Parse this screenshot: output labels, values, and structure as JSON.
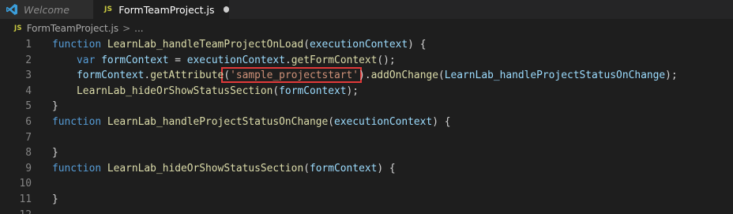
{
  "tabs": [
    {
      "label": "Welcome",
      "icon": "vscode-logo-icon",
      "active": false
    },
    {
      "label": "FormTeamProject.js",
      "icon": "js-file-icon",
      "icon_text": "JS",
      "active": true,
      "unsaved": true
    }
  ],
  "breadcrumb": {
    "icon_text": "JS",
    "file": "FormTeamProject.js",
    "separator": ">",
    "more": "..."
  },
  "editor": {
    "lines": [
      {
        "n": "1",
        "tokens": [
          {
            "t": "function",
            "c": "kw"
          },
          {
            "t": " ",
            "c": "pn"
          },
          {
            "t": "LearnLab_handleTeamProjectOnLoad",
            "c": "fn"
          },
          {
            "t": "(",
            "c": "pn"
          },
          {
            "t": "executionContext",
            "c": "var"
          },
          {
            "t": ") {",
            "c": "pn"
          }
        ]
      },
      {
        "n": "2",
        "tokens": [
          {
            "t": "    ",
            "c": "pn"
          },
          {
            "t": "var",
            "c": "kw"
          },
          {
            "t": " ",
            "c": "pn"
          },
          {
            "t": "formContext",
            "c": "var"
          },
          {
            "t": " = ",
            "c": "pn"
          },
          {
            "t": "executionContext",
            "c": "var"
          },
          {
            "t": ".",
            "c": "pn"
          },
          {
            "t": "getFormContext",
            "c": "fn"
          },
          {
            "t": "();",
            "c": "pn"
          }
        ]
      },
      {
        "n": "3",
        "tokens": [
          {
            "t": "    ",
            "c": "pn"
          },
          {
            "t": "formContext",
            "c": "var"
          },
          {
            "t": ".",
            "c": "pn"
          },
          {
            "t": "getAttribute",
            "c": "fn"
          },
          {
            "t": "(",
            "c": "pn"
          },
          {
            "t": "'sample_projectstart'",
            "c": "str"
          },
          {
            "t": ").",
            "c": "pn"
          },
          {
            "t": "addOnChange",
            "c": "fn"
          },
          {
            "t": "(",
            "c": "pn"
          },
          {
            "t": "LearnLab_handleProjectStatusOnChange",
            "c": "var"
          },
          {
            "t": ");",
            "c": "pn"
          }
        ]
      },
      {
        "n": "4",
        "tokens": [
          {
            "t": "    ",
            "c": "pn"
          },
          {
            "t": "LearnLab_hideOrShowStatusSection",
            "c": "fn"
          },
          {
            "t": "(",
            "c": "pn"
          },
          {
            "t": "formContext",
            "c": "var"
          },
          {
            "t": ");",
            "c": "pn"
          }
        ]
      },
      {
        "n": "5",
        "tokens": [
          {
            "t": "}",
            "c": "pn"
          }
        ]
      },
      {
        "n": "6",
        "tokens": [
          {
            "t": "function",
            "c": "kw"
          },
          {
            "t": " ",
            "c": "pn"
          },
          {
            "t": "LearnLab_handleProjectStatusOnChange",
            "c": "fn"
          },
          {
            "t": "(",
            "c": "pn"
          },
          {
            "t": "executionContext",
            "c": "var"
          },
          {
            "t": ") {",
            "c": "pn"
          }
        ]
      },
      {
        "n": "7",
        "tokens": []
      },
      {
        "n": "8",
        "tokens": [
          {
            "t": "}",
            "c": "pn"
          }
        ]
      },
      {
        "n": "9",
        "tokens": [
          {
            "t": "function",
            "c": "kw"
          },
          {
            "t": " ",
            "c": "pn"
          },
          {
            "t": "LearnLab_hideOrShowStatusSection",
            "c": "fn"
          },
          {
            "t": "(",
            "c": "pn"
          },
          {
            "t": "formContext",
            "c": "var"
          },
          {
            "t": ") {",
            "c": "pn"
          }
        ]
      },
      {
        "n": "10",
        "tokens": []
      },
      {
        "n": "11",
        "tokens": [
          {
            "t": "}",
            "c": "pn"
          }
        ]
      },
      {
        "n": "12",
        "tokens": []
      }
    ]
  },
  "colors": {
    "keyword": "#569cd6",
    "function": "#dcdcaa",
    "variable": "#9cdcfe",
    "string": "#ce9178",
    "highlight_box": "#e23a3a"
  }
}
